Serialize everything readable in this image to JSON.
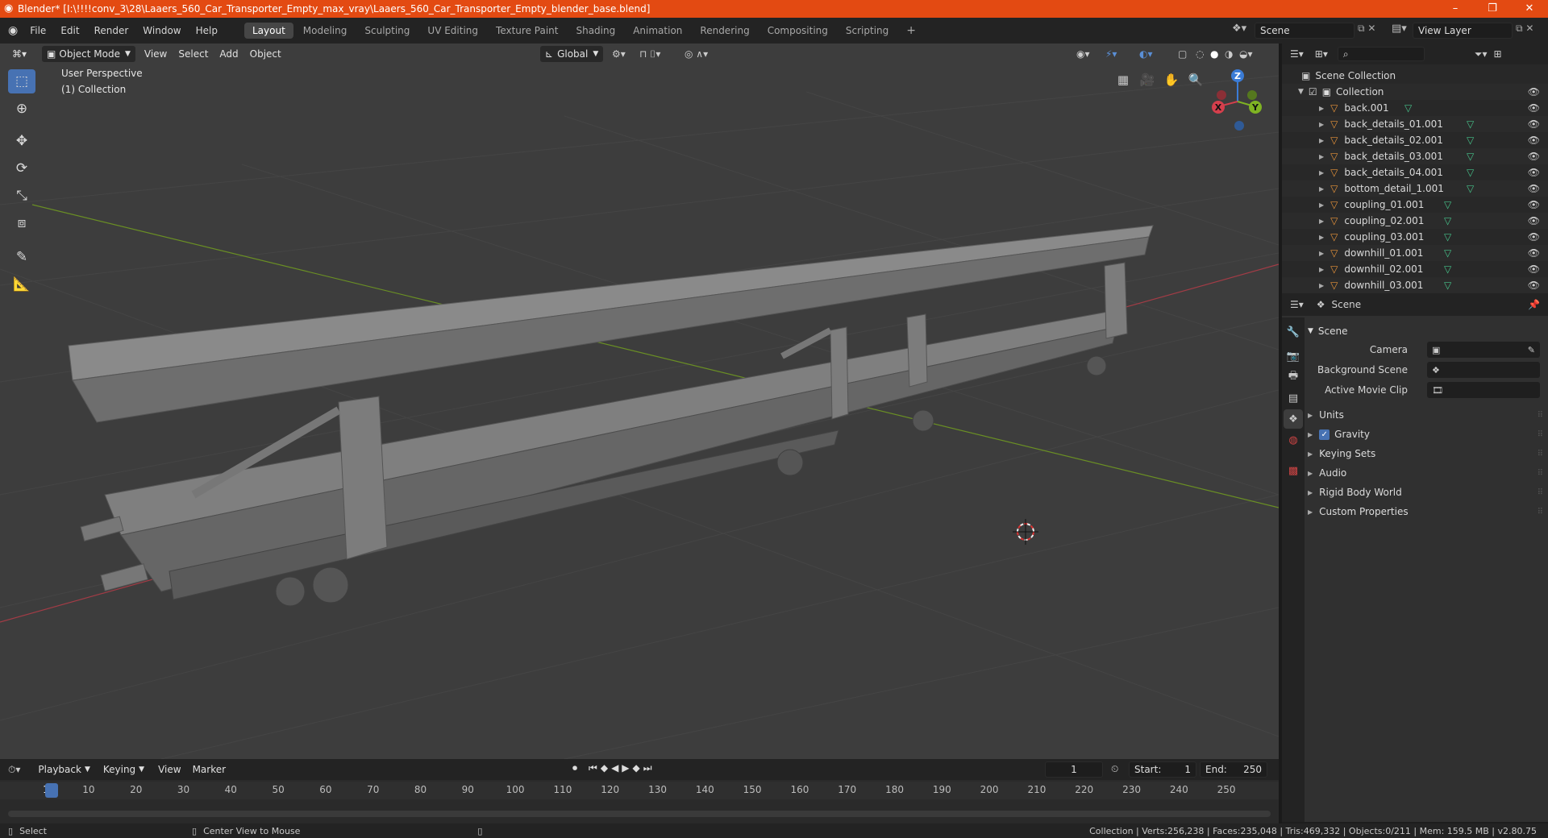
{
  "window": {
    "title": "Blender* [I:\\!!!!conv_3\\28\\Laaers_560_Car_Transporter_Empty_max_vray\\Laaers_560_Car_Transporter_Empty_blender_base.blend]",
    "minimize": "–",
    "maximize": "❐",
    "close": "✕"
  },
  "menu": [
    "File",
    "Edit",
    "Render",
    "Window",
    "Help"
  ],
  "workspaces": [
    "Layout",
    "Modeling",
    "Sculpting",
    "UV Editing",
    "Texture Paint",
    "Shading",
    "Animation",
    "Rendering",
    "Compositing",
    "Scripting"
  ],
  "workspace_active": "Layout",
  "scene_field": "Scene",
  "view_layer_field": "View Layer",
  "viewport": {
    "mode": "Object Mode",
    "menus": [
      "View",
      "Select",
      "Add",
      "Object"
    ],
    "orientation": "Global",
    "overlay_text_1": "User Perspective",
    "overlay_text_2": "(1) Collection",
    "gizmo": {
      "x": "X",
      "y": "Y",
      "z": "Z"
    },
    "colors": {
      "x_axis": "#a23c46",
      "y_axis": "#6a8f24",
      "bg": "#3d3d3d"
    }
  },
  "outliner": {
    "root": "Scene Collection",
    "collection": "Collection",
    "items": [
      "back.001",
      "back_details_01.001",
      "back_details_02.001",
      "back_details_03.001",
      "back_details_04.001",
      "bottom_detail_1.001",
      "coupling_01.001",
      "coupling_02.001",
      "coupling_03.001",
      "downhill_01.001",
      "downhill_02.001",
      "downhill_03.001"
    ]
  },
  "properties": {
    "context": "Scene",
    "section": "Scene",
    "fields": [
      {
        "label": "Camera",
        "icon": "camera-icon"
      },
      {
        "label": "Background Scene",
        "icon": "scene-icon"
      },
      {
        "label": "Active Movie Clip",
        "icon": "clip-icon"
      }
    ],
    "panels": [
      "Units",
      "Gravity",
      "Keying Sets",
      "Audio",
      "Rigid Body World",
      "Custom Properties"
    ],
    "gravity_checked": true
  },
  "timeline": {
    "menus": [
      "Playback",
      "Keying",
      "View",
      "Marker"
    ],
    "current_frame": "1",
    "start_label": "Start:",
    "start": "1",
    "end_label": "End:",
    "end": "250",
    "ticks": [
      "1",
      "10",
      "20",
      "30",
      "40",
      "50",
      "60",
      "70",
      "80",
      "90",
      "100",
      "110",
      "120",
      "130",
      "140",
      "150",
      "160",
      "170",
      "180",
      "190",
      "200",
      "210",
      "220",
      "230",
      "240",
      "250"
    ]
  },
  "status": {
    "left": "Select",
    "middle": "Center View to Mouse",
    "right": "Collection | Verts:256,238 | Faces:235,048 | Tris:469,332 | Objects:0/211 | Mem: 159.5 MB | v2.80.75"
  }
}
